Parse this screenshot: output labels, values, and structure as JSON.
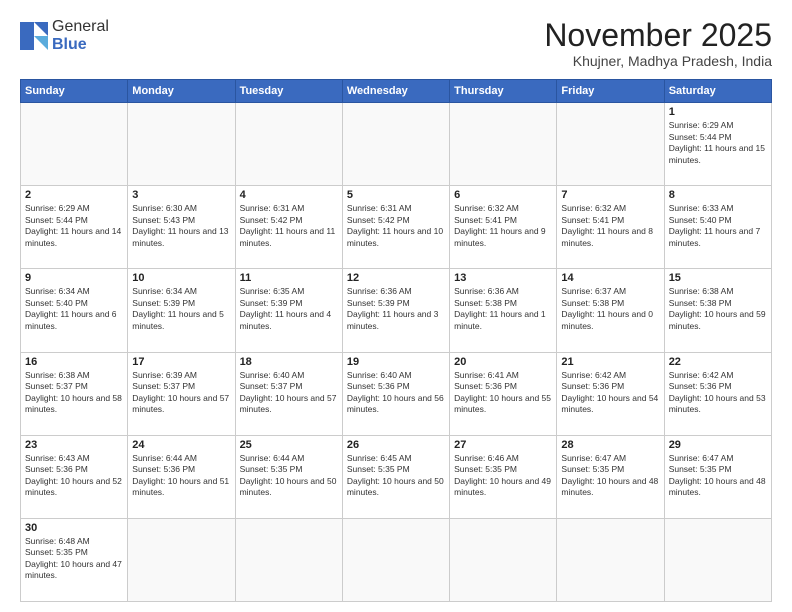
{
  "logo": {
    "line1": "General",
    "line2": "Blue"
  },
  "title": "November 2025",
  "subtitle": "Khujner, Madhya Pradesh, India",
  "days_of_week": [
    "Sunday",
    "Monday",
    "Tuesday",
    "Wednesday",
    "Thursday",
    "Friday",
    "Saturday"
  ],
  "weeks": [
    [
      {
        "day": null
      },
      {
        "day": null
      },
      {
        "day": null
      },
      {
        "day": null
      },
      {
        "day": null
      },
      {
        "day": null
      },
      {
        "day": 1,
        "sunrise": "6:29 AM",
        "sunset": "5:44 PM",
        "daylight": "11 hours and 15 minutes."
      }
    ],
    [
      {
        "day": 2,
        "sunrise": "6:29 AM",
        "sunset": "5:44 PM",
        "daylight": "11 hours and 14 minutes."
      },
      {
        "day": 3,
        "sunrise": "6:30 AM",
        "sunset": "5:43 PM",
        "daylight": "11 hours and 13 minutes."
      },
      {
        "day": 4,
        "sunrise": "6:31 AM",
        "sunset": "5:42 PM",
        "daylight": "11 hours and 11 minutes."
      },
      {
        "day": 5,
        "sunrise": "6:31 AM",
        "sunset": "5:42 PM",
        "daylight": "11 hours and 10 minutes."
      },
      {
        "day": 6,
        "sunrise": "6:32 AM",
        "sunset": "5:41 PM",
        "daylight": "11 hours and 9 minutes."
      },
      {
        "day": 7,
        "sunrise": "6:32 AM",
        "sunset": "5:41 PM",
        "daylight": "11 hours and 8 minutes."
      },
      {
        "day": 8,
        "sunrise": "6:33 AM",
        "sunset": "5:40 PM",
        "daylight": "11 hours and 7 minutes."
      }
    ],
    [
      {
        "day": 9,
        "sunrise": "6:34 AM",
        "sunset": "5:40 PM",
        "daylight": "11 hours and 6 minutes."
      },
      {
        "day": 10,
        "sunrise": "6:34 AM",
        "sunset": "5:39 PM",
        "daylight": "11 hours and 5 minutes."
      },
      {
        "day": 11,
        "sunrise": "6:35 AM",
        "sunset": "5:39 PM",
        "daylight": "11 hours and 4 minutes."
      },
      {
        "day": 12,
        "sunrise": "6:36 AM",
        "sunset": "5:39 PM",
        "daylight": "11 hours and 3 minutes."
      },
      {
        "day": 13,
        "sunrise": "6:36 AM",
        "sunset": "5:38 PM",
        "daylight": "11 hours and 1 minute."
      },
      {
        "day": 14,
        "sunrise": "6:37 AM",
        "sunset": "5:38 PM",
        "daylight": "11 hours and 0 minutes."
      },
      {
        "day": 15,
        "sunrise": "6:38 AM",
        "sunset": "5:38 PM",
        "daylight": "10 hours and 59 minutes."
      }
    ],
    [
      {
        "day": 16,
        "sunrise": "6:38 AM",
        "sunset": "5:37 PM",
        "daylight": "10 hours and 58 minutes."
      },
      {
        "day": 17,
        "sunrise": "6:39 AM",
        "sunset": "5:37 PM",
        "daylight": "10 hours and 57 minutes."
      },
      {
        "day": 18,
        "sunrise": "6:40 AM",
        "sunset": "5:37 PM",
        "daylight": "10 hours and 57 minutes."
      },
      {
        "day": 19,
        "sunrise": "6:40 AM",
        "sunset": "5:36 PM",
        "daylight": "10 hours and 56 minutes."
      },
      {
        "day": 20,
        "sunrise": "6:41 AM",
        "sunset": "5:36 PM",
        "daylight": "10 hours and 55 minutes."
      },
      {
        "day": 21,
        "sunrise": "6:42 AM",
        "sunset": "5:36 PM",
        "daylight": "10 hours and 54 minutes."
      },
      {
        "day": 22,
        "sunrise": "6:42 AM",
        "sunset": "5:36 PM",
        "daylight": "10 hours and 53 minutes."
      }
    ],
    [
      {
        "day": 23,
        "sunrise": "6:43 AM",
        "sunset": "5:36 PM",
        "daylight": "10 hours and 52 minutes."
      },
      {
        "day": 24,
        "sunrise": "6:44 AM",
        "sunset": "5:36 PM",
        "daylight": "10 hours and 51 minutes."
      },
      {
        "day": 25,
        "sunrise": "6:44 AM",
        "sunset": "5:35 PM",
        "daylight": "10 hours and 50 minutes."
      },
      {
        "day": 26,
        "sunrise": "6:45 AM",
        "sunset": "5:35 PM",
        "daylight": "10 hours and 50 minutes."
      },
      {
        "day": 27,
        "sunrise": "6:46 AM",
        "sunset": "5:35 PM",
        "daylight": "10 hours and 49 minutes."
      },
      {
        "day": 28,
        "sunrise": "6:47 AM",
        "sunset": "5:35 PM",
        "daylight": "10 hours and 48 minutes."
      },
      {
        "day": 29,
        "sunrise": "6:47 AM",
        "sunset": "5:35 PM",
        "daylight": "10 hours and 48 minutes."
      }
    ],
    [
      {
        "day": 30,
        "sunrise": "6:48 AM",
        "sunset": "5:35 PM",
        "daylight": "10 hours and 47 minutes."
      },
      {
        "day": null
      },
      {
        "day": null
      },
      {
        "day": null
      },
      {
        "day": null
      },
      {
        "day": null
      },
      {
        "day": null
      }
    ]
  ]
}
